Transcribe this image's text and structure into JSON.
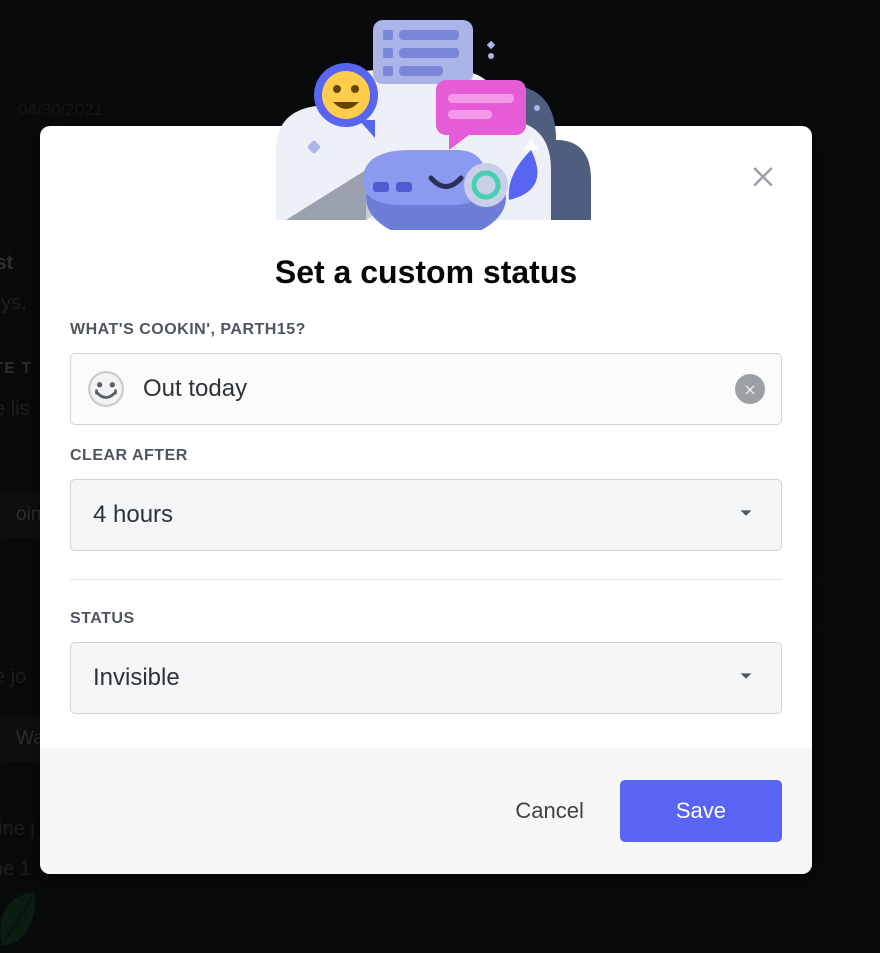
{
  "background": {
    "date1": "04/30/2021",
    "frag_wst": "wst",
    "frag_uys": "uys,",
    "frag_ite": "ITE T",
    "frag_elis": "e lis",
    "btn_join": "oin",
    "frag_ejo": "e jo",
    "btn_wave": "Wav",
    "frag_vine": "vine  j",
    "frag_ne1": "ne   1"
  },
  "modal": {
    "title": "Set a custom status",
    "prompt_label": "WHAT'S COOKIN', PARTH15?",
    "status_value": "Out today",
    "status_placeholder": "Out today",
    "clear_after_label": "CLEAR AFTER",
    "clear_after_value": "4 hours",
    "status_label": "STATUS",
    "status_select_value": "Invisible",
    "cancel": "Cancel",
    "save": "Save"
  },
  "colors": {
    "accent": "#5865f2"
  }
}
